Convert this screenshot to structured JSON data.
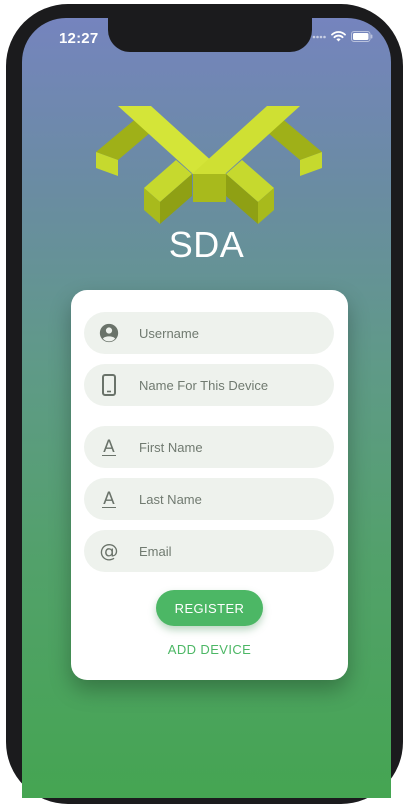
{
  "status_bar": {
    "time": "12:27",
    "icons": [
      "signal-dots-icon",
      "wifi-icon",
      "battery-icon"
    ]
  },
  "app": {
    "title": "SDA",
    "logo_color": "#c6d92e"
  },
  "form": {
    "fields": [
      {
        "icon": "account-circle-icon",
        "placeholder": "Username"
      },
      {
        "icon": "phone-icon",
        "placeholder": "Name For This Device"
      },
      {
        "icon": "text-format-icon",
        "placeholder": "First Name"
      },
      {
        "icon": "text-format-icon",
        "placeholder": "Last Name"
      },
      {
        "icon": "at-sign-icon",
        "placeholder": "Email"
      }
    ],
    "register_label": "REGISTER",
    "add_device_label": "ADD DEVICE"
  },
  "colors": {
    "accent": "#4cb765",
    "field_bg": "#eef2ed",
    "gradient_top": "#7584be",
    "gradient_bottom": "#45a552"
  }
}
